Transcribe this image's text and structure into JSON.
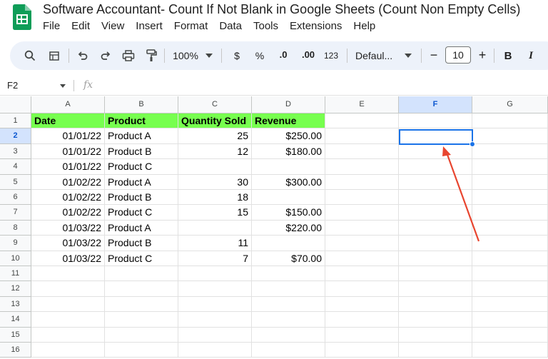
{
  "doc": {
    "title": "Software Accountant- Count If Not Blank in Google Sheets (Count Non Empty Cells)"
  },
  "menu": [
    "File",
    "Edit",
    "View",
    "Insert",
    "Format",
    "Data",
    "Tools",
    "Extensions",
    "Help"
  ],
  "toolbar": {
    "zoom": "100%",
    "currency": "$",
    "percent": "%",
    "dec_decrease": ".0",
    "dec_increase": ".00",
    "number_format": "123",
    "font": "Defaul...",
    "font_size": "10",
    "minus": "−",
    "plus": "+",
    "bold": "B",
    "italic": "I",
    "icons": [
      "search-icon",
      "paint-format-icon",
      "undo-icon",
      "redo-icon",
      "print-icon",
      "paint-roller-icon",
      "dropdown-icon"
    ]
  },
  "formula_bar": {
    "name_box": "F2",
    "fx": "fx"
  },
  "grid": {
    "columns": [
      "A",
      "B",
      "C",
      "D",
      "E",
      "F",
      "G"
    ],
    "selected_column": "F",
    "selected_row": "2",
    "rows": [
      {
        "num": "1",
        "cells": [
          "Date",
          "Product",
          "Quantity Sold",
          "Revenue",
          "",
          "",
          ""
        ]
      },
      {
        "num": "2",
        "cells": [
          "01/01/22",
          "Product A",
          "25",
          "$250.00",
          "",
          "",
          ""
        ]
      },
      {
        "num": "3",
        "cells": [
          "01/01/22",
          "Product B",
          "12",
          "$180.00",
          "",
          "",
          ""
        ]
      },
      {
        "num": "4",
        "cells": [
          "01/01/22",
          "Product C",
          "",
          "",
          "",
          "",
          ""
        ]
      },
      {
        "num": "5",
        "cells": [
          "01/02/22",
          "Product A",
          "30",
          "$300.00",
          "",
          "",
          ""
        ]
      },
      {
        "num": "6",
        "cells": [
          "01/02/22",
          "Product B",
          "18",
          "",
          "",
          "",
          ""
        ]
      },
      {
        "num": "7",
        "cells": [
          "01/02/22",
          "Product C",
          "15",
          "$150.00",
          "",
          "",
          ""
        ]
      },
      {
        "num": "8",
        "cells": [
          "01/03/22",
          "Product A",
          "",
          "$220.00",
          "",
          "",
          ""
        ]
      },
      {
        "num": "9",
        "cells": [
          "01/03/22",
          "Product B",
          "11",
          "",
          "",
          "",
          ""
        ]
      },
      {
        "num": "10",
        "cells": [
          "01/03/22",
          "Product C",
          "7",
          "$70.00",
          "",
          "",
          ""
        ]
      },
      {
        "num": "11",
        "cells": [
          "",
          "",
          "",
          "",
          "",
          "",
          ""
        ]
      },
      {
        "num": "12",
        "cells": [
          "",
          "",
          "",
          "",
          "",
          "",
          ""
        ]
      },
      {
        "num": "13",
        "cells": [
          "",
          "",
          "",
          "",
          "",
          "",
          ""
        ]
      },
      {
        "num": "14",
        "cells": [
          "",
          "",
          "",
          "",
          "",
          "",
          ""
        ]
      },
      {
        "num": "15",
        "cells": [
          "",
          "",
          "",
          "",
          "",
          "",
          ""
        ]
      },
      {
        "num": "16",
        "cells": [
          "",
          "",
          "",
          "",
          "",
          "",
          ""
        ]
      }
    ]
  },
  "colors": {
    "header_fill": "#77ff4f",
    "selection": "#1a73e8",
    "annotation_arrow": "#e8452f"
  }
}
